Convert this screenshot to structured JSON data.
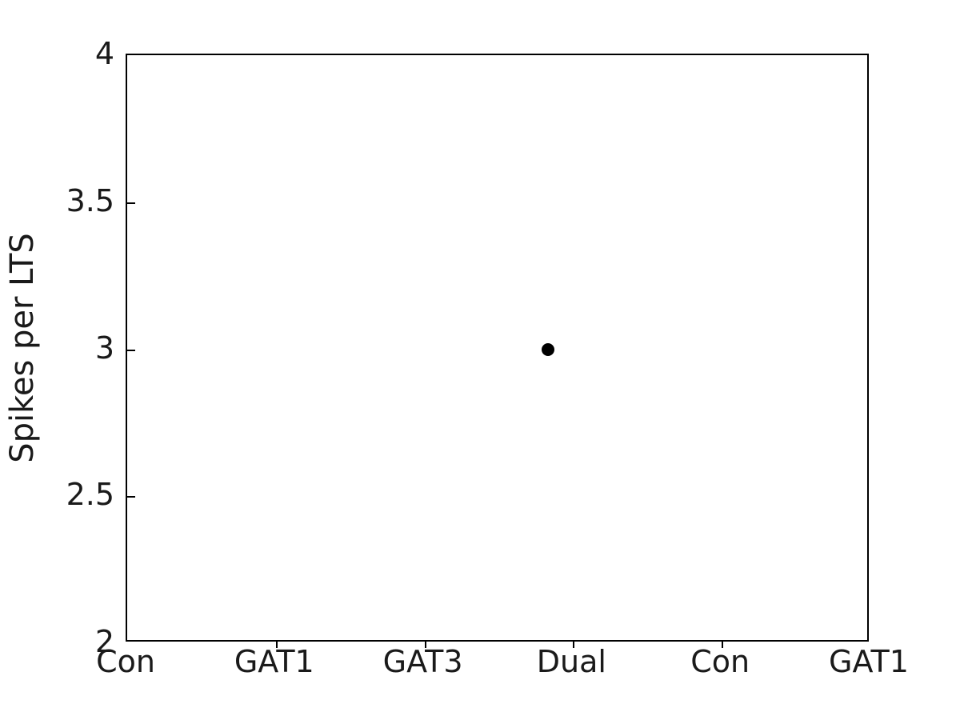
{
  "chart_data": {
    "type": "scatter",
    "title": "",
    "xlabel": "",
    "ylabel": "Spikes per LTS",
    "ylim": [
      2,
      4
    ],
    "yticks": [
      2,
      2.5,
      3,
      3.5,
      4
    ],
    "ytick_labels": [
      "2",
      "2.5",
      "3",
      "3.5",
      "4"
    ],
    "xtick_labels": [
      "Con",
      "GAT1",
      "GAT3",
      "Dual",
      "Con",
      "GAT1"
    ],
    "xtick_positions": [
      0,
      1,
      2,
      3,
      4,
      5
    ],
    "xlim": [
      0,
      5
    ],
    "grid": false,
    "legend": null,
    "marker": "filled-circle",
    "marker_color": "#000000",
    "marker_size_px": 16,
    "series": [
      {
        "name": "Spikes per LTS",
        "points": [
          {
            "x": 2.83,
            "y": 3.0,
            "group": "Dual"
          }
        ]
      }
    ],
    "annotations": []
  },
  "figure": {
    "background_color": "#ffffff",
    "axes_color": "#000000",
    "text_color": "#1a1a1a"
  }
}
